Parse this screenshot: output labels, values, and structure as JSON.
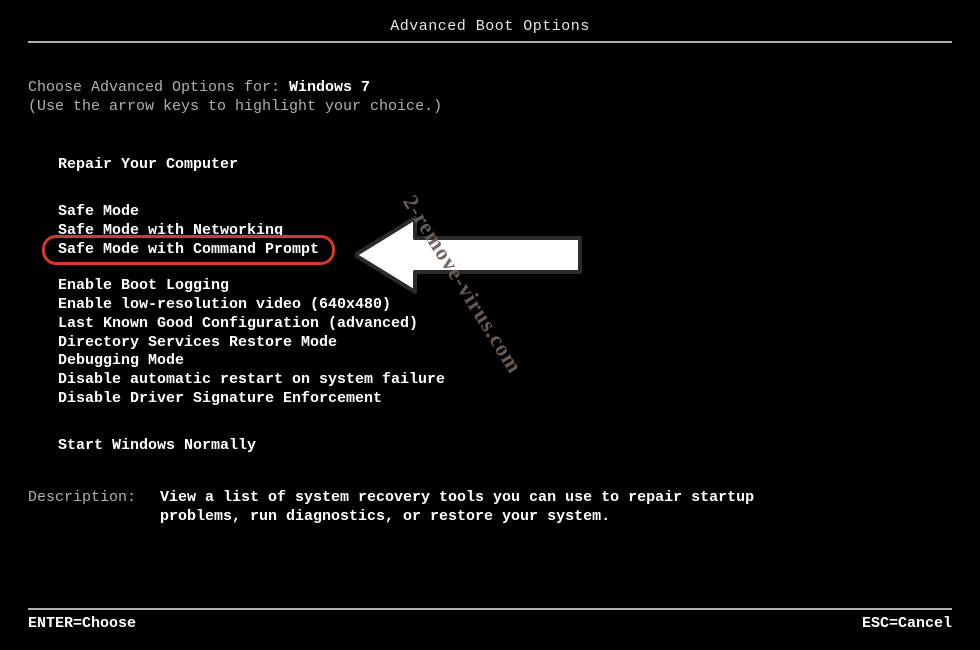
{
  "title": "Advanced Boot Options",
  "prompt": {
    "label": "Choose Advanced Options for: ",
    "os": "Windows 7",
    "hint": "(Use the arrow keys to highlight your choice.)"
  },
  "groups": {
    "repair": "Repair Your Computer",
    "safe": {
      "mode": "Safe Mode",
      "net": "Safe Mode with Networking",
      "cmd": "Safe Mode with Command Prompt"
    },
    "advanced": {
      "boot_log": "Enable Boot Logging",
      "low_res": "Enable low-resolution video (640x480)",
      "lkgc": "Last Known Good Configuration (advanced)",
      "dsrm": "Directory Services Restore Mode",
      "debug": "Debugging Mode",
      "no_auto_restart": "Disable automatic restart on system failure",
      "no_driver_sig": "Disable Driver Signature Enforcement"
    },
    "normal": "Start Windows Normally"
  },
  "description": {
    "label": "Description:",
    "text": "View a list of system recovery tools you can use to repair startup problems, run diagnostics, or restore your system."
  },
  "footer": {
    "enter": "ENTER=Choose",
    "esc": "ESC=Cancel"
  },
  "watermark": "2-remove-virus.com",
  "highlight_color": "#d03a2a"
}
